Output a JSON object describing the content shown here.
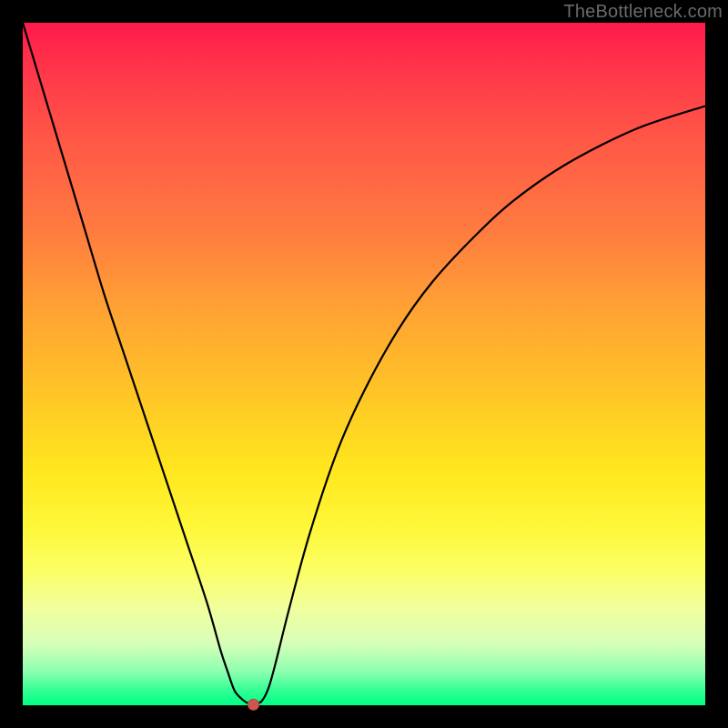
{
  "watermark": "TheBottleneck.com",
  "chart_data": {
    "type": "line",
    "title": "",
    "xlabel": "",
    "ylabel": "",
    "xlim": [
      0,
      100
    ],
    "ylim": [
      0,
      100
    ],
    "grid": false,
    "legend": false,
    "series": [
      {
        "name": "bottleneck-curve",
        "x": [
          0,
          3,
          6,
          9,
          12,
          15,
          18,
          21,
          24,
          27,
          29,
          30,
          31,
          32,
          33,
          34,
          35,
          36,
          37,
          39,
          42,
          46,
          50,
          55,
          60,
          66,
          72,
          80,
          90,
          100
        ],
        "values": [
          100,
          90,
          80,
          70,
          60,
          51,
          42,
          33,
          24,
          15,
          8,
          5,
          2.2,
          1,
          0.3,
          0.2,
          0.6,
          2.5,
          6,
          14,
          25,
          37,
          46,
          55,
          62,
          68.5,
          74,
          79.5,
          84.5,
          87.8
        ]
      }
    ],
    "minimum_point": {
      "x": 33.8,
      "y": 0.1
    },
    "background_gradient": {
      "top": "#ff1a4b",
      "mid_upper": "#ff7a40",
      "mid": "#ffe81f",
      "mid_lower": "#d6ffb8",
      "bottom": "#00ff86"
    }
  }
}
